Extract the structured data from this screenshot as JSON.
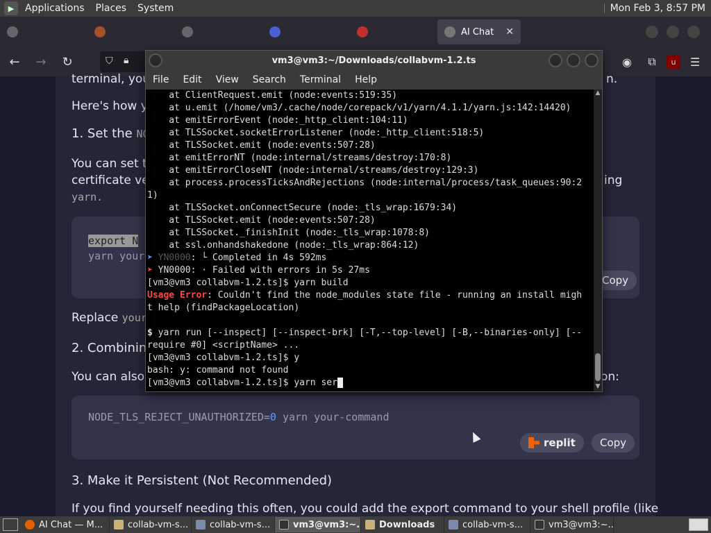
{
  "top_panel": {
    "menu": [
      "Applications",
      "Places",
      "System"
    ],
    "clock": "Mon Feb  3,  8:57 PM"
  },
  "browser": {
    "active_tab": "AI Chat",
    "close_glyph": "✕"
  },
  "page": {
    "partial_text_1": "terminal, you",
    "partial_text_2": "Here's how yo",
    "heading_1": "1. Set the",
    "heading_1_code": "NO",
    "para_1a": "You can set th",
    "para_1b": "certificate ver",
    "para_1c_tail": "ing",
    "para_1d": "yarn.",
    "code_1_line1": "export N",
    "code_1_line2": "yarn your",
    "copy_label": "Copy",
    "replace_text": "Replace",
    "replace_code": "your",
    "heading_2": "2. Combinin",
    "para_2": "You can also",
    "para_2_tail": "on:",
    "code_2_prefix": "NODE_TLS_REJECT_UNAUTHORIZED=",
    "code_2_zero": "0",
    "code_2_suffix": " yarn your-command",
    "replit_label": "replit",
    "copy_label_2": "Copy",
    "heading_3": "3. Make it Persistent (Not Recommended)",
    "para_3": "If you find yourself needing this often, you could add the export command to your shell profile (like",
    "right_tail": "n."
  },
  "terminal": {
    "title": "vm3@vm3:~/Downloads/collabvm-1.2.ts",
    "menu": [
      "File",
      "Edit",
      "View",
      "Search",
      "Terminal",
      "Help"
    ],
    "lines": [
      "    at ClientRequest.emit (node:events:519:35)",
      "    at u.emit (/home/vm3/.cache/node/corepack/v1/yarn/4.1.1/yarn.js:142:14420)",
      "    at emitErrorEvent (node:_http_client:104:11)",
      "    at TLSSocket.socketErrorListener (node:_http_client:518:5)",
      "    at TLSSocket.emit (node:events:507:28)",
      "    at emitErrorNT (node:internal/streams/destroy:170:8)",
      "    at emitErrorCloseNT (node:internal/streams/destroy:129:3)",
      "    at process.processTicksAndRejections (node:internal/process/task_queues:90:2",
      "1)",
      "    at TLSSocket.onConnectSecure (node:_tls_wrap:1679:34)",
      "    at TLSSocket.emit (node:events:507:28)",
      "    at TLSSocket._finishInit (node:_tls_wrap:1078:8)",
      "    at ssl.onhandshakedone (node:_tls_wrap:864:12)"
    ],
    "completed_code": "YN0000",
    "completed_text": ": └ Completed in 4s 592ms",
    "failed_text": "YN0000: · Failed with errors in 5s 27ms",
    "prompt_1": "[vm3@vm3 collabvm-1.2.ts]$ yarn build",
    "usage_label": "Usage Error",
    "usage_text_1": ": Couldn't find the node_modules state file - running an install migh",
    "usage_text_2": "t help (findPackageLocation)",
    "usage_dollar": "$",
    "usage_cmd_1": " yarn run [--inspect] [--inspect-brk] [-T,--top-level] [-B,--binaries-only] [--",
    "usage_cmd_2": "require #0] <scriptName> ...",
    "prompt_2": "[vm3@vm3 collabvm-1.2.ts]$ y",
    "bash_err": "bash: y: command not found",
    "prompt_3": "[vm3@vm3 collabvm-1.2.ts]$ yarn ser"
  },
  "taskbar": {
    "tasks": [
      "AI Chat — M...",
      "collab-vm-s...",
      "collab-vm-s...",
      "vm3@vm3:~...",
      "Downloads",
      "collab-vm-s...",
      "vm3@vm3:~..."
    ]
  }
}
